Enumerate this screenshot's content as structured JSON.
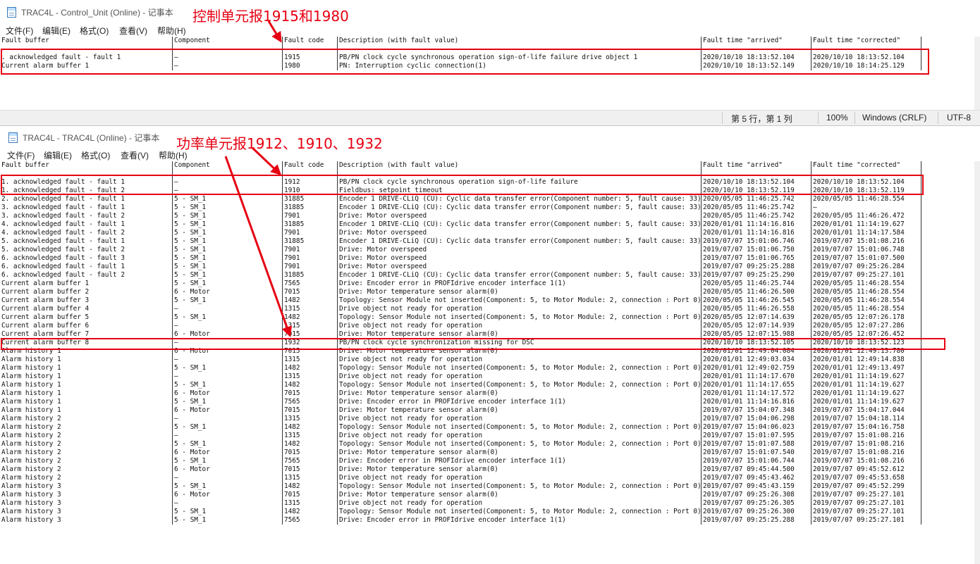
{
  "win1": {
    "title": "TRAC4L - Control_Unit (Online) - 记事本",
    "menu": [
      "文件(F)",
      "编辑(E)",
      "格式(O)",
      "查看(V)",
      "帮助(H)"
    ],
    "header": [
      "Fault buffer",
      "Component",
      "Fault code",
      "Description (with fault value)",
      "Fault time \"arrived\"",
      "Fault time \"corrected\""
    ],
    "rows": [
      [
        "",
        "",
        "",
        "",
        "",
        ""
      ],
      [
        ". acknowledged fault - fault 1",
        "—",
        "1915",
        "PB/PN clock cycle synchronous operation sign-of-life failure drive object 1",
        "2020/10/10 18:13:52.104",
        "2020/10/10 18:13:52.104"
      ],
      [
        "Current alarm buffer 1",
        "—",
        "1980",
        "PN: Interruption cyclic connection(1)",
        "2020/10/10 18:13:52.149",
        "2020/10/10 18:14:25.129"
      ]
    ],
    "status": {
      "position": "第 5 行，第 1 列",
      "zoom": "100%",
      "eol": "Windows (CRLF)",
      "encoding": "UTF-8"
    }
  },
  "win2": {
    "title": "TRAC4L - TRAC4L (Online) - 记事本",
    "menu": [
      "文件(F)",
      "编辑(E)",
      "格式(O)",
      "查看(V)",
      "帮助(H)"
    ],
    "header": [
      "Fault buffer",
      "Component",
      "Fault code",
      "Description (with fault value)",
      "Fault time \"arrived\"",
      "Fault time \"corrected\""
    ],
    "rows": [
      [
        "",
        "",
        "",
        "",
        "",
        ""
      ],
      [
        "1. acknowledged fault - fault 1",
        "—",
        "1912",
        "PB/PN clock cycle synchronous operation sign-of-life failure",
        "2020/10/10 18:13:52.104",
        "2020/10/10 18:13:52.104"
      ],
      [
        "1. acknowledged fault - fault 2",
        "—",
        "1910",
        "Fieldbus: setpoint timeout",
        "2020/10/10 18:13:52.119",
        "2020/10/10 18:13:52.119"
      ],
      [
        "2. acknowledged fault - fault 1",
        "5 - SM_1",
        "31885",
        "Encoder 1 DRIVE-CLiQ (CU): Cyclic data transfer error(Component number: 5, fault cause: 33)",
        "2020/05/05 11:46:25.742",
        "2020/05/05 11:46:28.554"
      ],
      [
        "3. acknowledged fault - fault 1",
        "5 - SM_1",
        "31885",
        "Encoder 1 DRIVE-CLiQ (CU): Cyclic data transfer error(Component number: 5, fault cause: 33)",
        "2020/05/05 11:46:25.742",
        "—"
      ],
      [
        "3. acknowledged fault - fault 2",
        "5 - SM_1",
        "7901",
        "Drive: Motor overspeed",
        "2020/05/05 11:46:25.742",
        "2020/05/05 11:46:26.472"
      ],
      [
        "4. acknowledged fault - fault 1",
        "5 - SM_1",
        "31885",
        "Encoder 1 DRIVE-CLiQ (CU): Cyclic data transfer error(Component number: 5, fault cause: 33)",
        "2020/01/01 11:14:16.816",
        "2020/01/01 11:14:19.627"
      ],
      [
        "4. acknowledged fault - fault 2",
        "5 - SM_1",
        "7901",
        "Drive: Motor overspeed",
        "2020/01/01 11:14:16.816",
        "2020/01/01 11:14:17.584"
      ],
      [
        "5. acknowledged fault - fault 1",
        "5 - SM_1",
        "31885",
        "Encoder 1 DRIVE-CLiQ (CU): Cyclic data transfer error(Component number: 5, fault cause: 33)",
        "2019/07/07 15:01:06.746",
        "2019/07/07 15:01:08.216"
      ],
      [
        "5. acknowledged fault - fault 2",
        "5 - SM_1",
        "7901",
        "Drive: Motor overspeed",
        "2019/07/07 15:01:06.750",
        "2019/07/07 15:01:06.748"
      ],
      [
        "6. acknowledged fault - fault 3",
        "5 - SM_1",
        "7901",
        "Drive: Motor overspeed",
        "2019/07/07 15:01:06.765",
        "2019/07/07 15:01:07.500"
      ],
      [
        "6. acknowledged fault - fault 1",
        "5 - SM_1",
        "7901",
        "Drive: Motor overspeed",
        "2019/07/07 09:25:25.288",
        "2019/07/07 09:25:26.284"
      ],
      [
        "6. acknowledged fault - fault 2",
        "5 - SM_1",
        "31885",
        "Encoder 1 DRIVE-CLiQ (CU): Cyclic data transfer error(Component number: 5, fault cause: 33)",
        "2019/07/07 09:25:25.290",
        "2019/07/07 09:25:27.101"
      ],
      [
        "Current alarm buffer 1",
        "5 - SM_1",
        "7565",
        "Drive: Encoder error in PROFIdrive encoder interface 1(1)",
        "2020/05/05 11:46:25.744",
        "2020/05/05 11:46:28.554"
      ],
      [
        "Current alarm buffer 2",
        "6 - Motor",
        "7015",
        "Drive: Motor temperature sensor alarm(0)",
        "2020/05/05 11:46:26.500",
        "2020/05/05 11:46:28.554"
      ],
      [
        "Current alarm buffer 3",
        "5 - SM_1",
        "1482",
        "Topology: Sensor Module not inserted(Component: 5, to Motor Module: 2, connection : Port 0)",
        "2020/05/05 11:46:26.545",
        "2020/05/05 11:46:28.554"
      ],
      [
        "Current alarm buffer 4",
        "—",
        "1315",
        "Drive object not ready for operation",
        "2020/05/05 11:46:26.558",
        "2020/05/05 11:46:28.554"
      ],
      [
        "Current alarm buffer 5",
        "5 - SM_1",
        "1482",
        "Topology: Sensor Module not inserted(Component: 5, to Motor Module: 2, connection : Port 0)",
        "2020/05/05 12:07:14.639",
        "2020/05/05 12:07:26.178"
      ],
      [
        "Current alarm buffer 6",
        "—",
        "1315",
        "Drive object not ready for operation",
        "2020/05/05 12:07:14.939",
        "2020/05/05 12:07:27.286"
      ],
      [
        "Current alarm buffer 7",
        "6 - Motor",
        "7015",
        "Drive: Motor temperature sensor alarm(0)",
        "2020/05/05 12:07:15.988",
        "2020/05/05 12:07:26.452"
      ],
      [
        "Current alarm buffer 8",
        "—",
        "1932",
        "PB/PN clock cycle synchronization missing for DSC",
        "2020/10/10 18:13:52.105",
        "2020/10/10 18:13:52.123"
      ],
      [
        "Alarm history 1",
        "6 - Motor",
        "7015",
        "Drive: Motor temperature sensor alarm(0)",
        "2020/01/01 12:49:04.084",
        "2020/01/01 12:49:13.780"
      ],
      [
        "Alarm history 1",
        "—",
        "1315",
        "Drive object not ready for operation",
        "2020/01/01 12:49:03.034",
        "2020/01/01 12:49:14.838"
      ],
      [
        "Alarm history 1",
        "5 - SM_1",
        "1482",
        "Topology: Sensor Module not inserted(Component: 5, to Motor Module: 2, connection : Port 0)",
        "2020/01/01 12:49:02.759",
        "2020/01/01 12:49:13.497"
      ],
      [
        "Alarm history 1",
        "—",
        "1315",
        "Drive object not ready for operation",
        "2020/01/01 11:14:17.670",
        "2020/01/01 11:14:19.627"
      ],
      [
        "Alarm history 1",
        "5 - SM_1",
        "1482",
        "Topology: Sensor Module not inserted(Component: 5, to Motor Module: 2, connection : Port 0)",
        "2020/01/01 11:14:17.655",
        "2020/01/01 11:14:19.627"
      ],
      [
        "Alarm history 1",
        "6 - Motor",
        "7015",
        "Drive: Motor temperature sensor alarm(0)",
        "2020/01/01 11:14:17.572",
        "2020/01/01 11:14:19.627"
      ],
      [
        "Alarm history 1",
        "5 - SM_1",
        "7565",
        "Drive: Encoder error in PROFIdrive encoder interface 1(1)",
        "2020/01/01 11:14:16.816",
        "2020/01/01 11:14:19.627"
      ],
      [
        "Alarm history 1",
        "6 - Motor",
        "7015",
        "Drive: Motor temperature sensor alarm(0)",
        "2019/07/07 15:04:07.348",
        "2019/07/07 15:04:17.044"
      ],
      [
        "Alarm history 2",
        "—",
        "1315",
        "Drive object not ready for operation",
        "2019/07/07 15:04:06.298",
        "2019/07/07 15:04:18.114"
      ],
      [
        "Alarm history 2",
        "5 - SM_1",
        "1482",
        "Topology: Sensor Module not inserted(Component: 5, to Motor Module: 2, connection : Port 0)",
        "2019/07/07 15:04:06.023",
        "2019/07/07 15:04:16.758"
      ],
      [
        "Alarm history 2",
        "—",
        "1315",
        "Drive object not ready for operation",
        "2019/07/07 15:01:07.595",
        "2019/07/07 15:01:08.216"
      ],
      [
        "Alarm history 2",
        "5 - SM_1",
        "1482",
        "Topology: Sensor Module not inserted(Component: 5, to Motor Module: 2, connection : Port 0)",
        "2019/07/07 15:01:07.588",
        "2019/07/07 15:01:08.216"
      ],
      [
        "Alarm history 2",
        "6 - Motor",
        "7015",
        "Drive: Motor temperature sensor alarm(0)",
        "2019/07/07 15:01:07.540",
        "2019/07/07 15:01:08.216"
      ],
      [
        "Alarm history 2",
        "5 - SM_1",
        "7565",
        "Drive: Encoder error in PROFIdrive encoder interface 1(1)",
        "2019/07/07 15:01:06.744",
        "2019/07/07 15:01:08.216"
      ],
      [
        "Alarm history 2",
        "6 - Motor",
        "7015",
        "Drive: Motor temperature sensor alarm(0)",
        "2019/07/07 09:45:44.500",
        "2019/07/07 09:45:52.612"
      ],
      [
        "Alarm history 2",
        "—",
        "1315",
        "Drive object not ready for operation",
        "2019/07/07 09:45:43.462",
        "2019/07/07 09:45:53.658"
      ],
      [
        "Alarm history 3",
        "5 - SM_1",
        "1482",
        "Topology: Sensor Module not inserted(Component: 5, to Motor Module: 2, connection : Port 0)",
        "2019/07/07 09:45:43.159",
        "2019/07/07 09:45:52.299"
      ],
      [
        "Alarm history 3",
        "6 - Motor",
        "7015",
        "Drive: Motor temperature sensor alarm(0)",
        "2019/07/07 09:25:26.308",
        "2019/07/07 09:25:27.101"
      ],
      [
        "Alarm history 3",
        "—",
        "1315",
        "Drive object not ready for operation",
        "2019/07/07 09:25:26.305",
        "2019/07/07 09:25:27.101"
      ],
      [
        "Alarm history 3",
        "5 - SM_1",
        "1482",
        "Topology: Sensor Module not inserted(Component: 5, to Motor Module: 2, connection : Port 0)",
        "2019/07/07 09:25:26.300",
        "2019/07/07 09:25:27.101"
      ],
      [
        "Alarm history 3",
        "5 - SM_1",
        "7565",
        "Drive: Encoder error in PROFIdrive encoder interface 1(1)",
        "2019/07/07 09:25:25.288",
        "2019/07/07 09:25:27.101"
      ]
    ]
  },
  "annotations": {
    "control_unit": "控制单元报1915和1980",
    "power_unit": "功率单元报1912、1910、1932"
  },
  "colors": {
    "annotation": "#e60012",
    "statusbar": "#f0f0f0"
  }
}
